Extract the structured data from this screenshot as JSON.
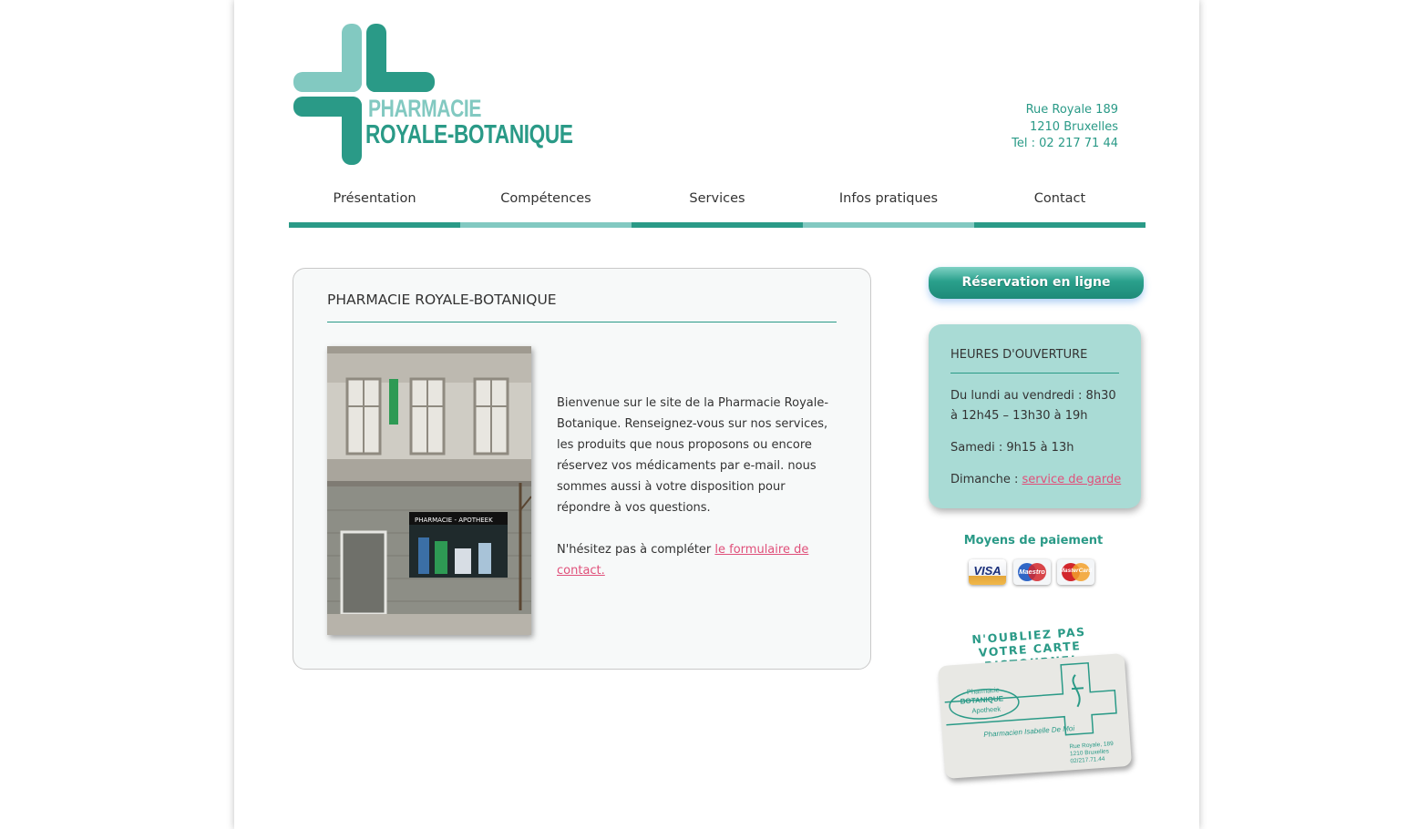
{
  "logo": {
    "line1": "PHARMACIE",
    "line2": "ROYALE-BOTANIQUE",
    "colors": {
      "light": "#82c9c1",
      "dark": "#2a9a87"
    }
  },
  "address": {
    "street": "Rue Royale 189",
    "city": "1210 Bruxelles",
    "phone": "Tel : 02 217 71 44"
  },
  "nav": {
    "items": [
      {
        "label": "Présentation"
      },
      {
        "label": "Compétences"
      },
      {
        "label": "Services"
      },
      {
        "label": "Infos pratiques"
      },
      {
        "label": "Contact"
      }
    ]
  },
  "main": {
    "title": "PHARMACIE ROYALE-BOTANIQUE",
    "photo_sign": "PHARMACIE - APOTHEEK",
    "intro": "Bienvenue sur le site de la Pharmacie Royale-Botanique. Renseignez-vous sur nos services, les produits que nous proposons ou encore réservez vos médicaments par e-mail. nous sommes aussi à votre disposition pour répondre à vos questions.",
    "contact_prefix": "N'hésitez pas à compléter ",
    "contact_link": "le formulaire de contact."
  },
  "sidebar": {
    "reservation_label": "Réservation en ligne",
    "hours": {
      "title": "HEURES D'OUVERTURE",
      "weekdays": "Du lundi au vendredi : 8h30 à 12h45 – 13h30 à 19h",
      "saturday": "Samedi : 9h15 à 13h",
      "sunday_prefix": "Dimanche : ",
      "sunday_link": "service de garde"
    },
    "payment": {
      "title": "Moyens de paiement",
      "cards": [
        "VISA",
        "Maestro",
        "MasterCard"
      ]
    },
    "reminder": {
      "line1": "N'OUBLIEZ PAS",
      "line2": "VOTRE CARTE RISTOURNE!"
    },
    "card": {
      "pharmacie": "Pharmacie",
      "botanique": "BOTANIQUE",
      "apotheek": "Apotheek",
      "pharmacien": "Pharmacien Isabelle De Moi",
      "addr1": "Rue Royale, 189",
      "addr2": "1210 Bruxelles",
      "addr3": "02/217.71.44"
    }
  }
}
